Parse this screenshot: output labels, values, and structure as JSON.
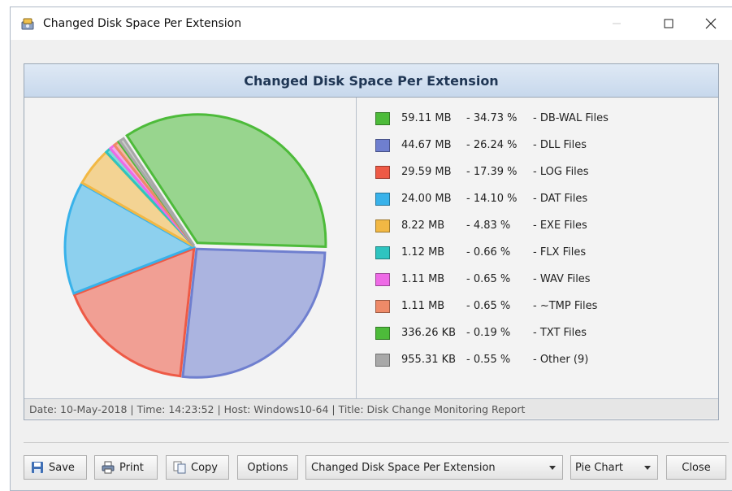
{
  "window": {
    "title": "Changed Disk Space Per Extension"
  },
  "chart": {
    "header": "Changed Disk Space Per Extension",
    "footer": "Date: 10-May-2018 | Time: 14:23:52 | Host: Windows10-64 | Title: Disk Change Monitoring Report"
  },
  "chart_data": {
    "type": "pie",
    "title": "Changed Disk Space Per Extension",
    "legend_position": "right",
    "slices": [
      {
        "size": "59.11 MB",
        "percent": "34.73 %",
        "label": "DB-WAL Files",
        "value": 34.73,
        "color": "#4dbb3a"
      },
      {
        "size": "44.67 MB",
        "percent": "26.24 %",
        "label": "DLL Files",
        "value": 26.24,
        "color": "#6f7fcf"
      },
      {
        "size": "29.59 MB",
        "percent": "17.39 %",
        "label": "LOG Files",
        "value": 17.39,
        "color": "#ee5a46"
      },
      {
        "size": "24.00 MB",
        "percent": "14.10 %",
        "label": "DAT Files",
        "value": 14.1,
        "color": "#38b2ea"
      },
      {
        "size": "8.22 MB",
        "percent": "4.83 %",
        "label": "EXE Files",
        "value": 4.83,
        "color": "#f2b844"
      },
      {
        "size": "1.12 MB",
        "percent": "0.66 %",
        "label": "FLX Files",
        "value": 0.66,
        "color": "#2ec4c0"
      },
      {
        "size": "1.11 MB",
        "percent": "0.65 %",
        "label": "WAV Files",
        "value": 0.65,
        "color": "#ee6ae6"
      },
      {
        "size": "1.11 MB",
        "percent": "0.65 %",
        "label": "~TMP Files",
        "value": 0.65,
        "color": "#ee8a68"
      },
      {
        "size": "336.26 KB",
        "percent": "0.19 %",
        "label": "TXT Files",
        "value": 0.19,
        "color": "#4dbb3a"
      },
      {
        "size": "955.31 KB",
        "percent": "0.55 %",
        "label": "Other (9)",
        "value": 0.55,
        "color": "#a8a8a8"
      }
    ]
  },
  "toolbar": {
    "save_label": "Save",
    "print_label": "Print",
    "copy_label": "Copy",
    "options_label": "Options",
    "report_select_value": "Changed Disk Space Per Extension",
    "chart_type_value": "Pie Chart",
    "close_label": "Close"
  }
}
